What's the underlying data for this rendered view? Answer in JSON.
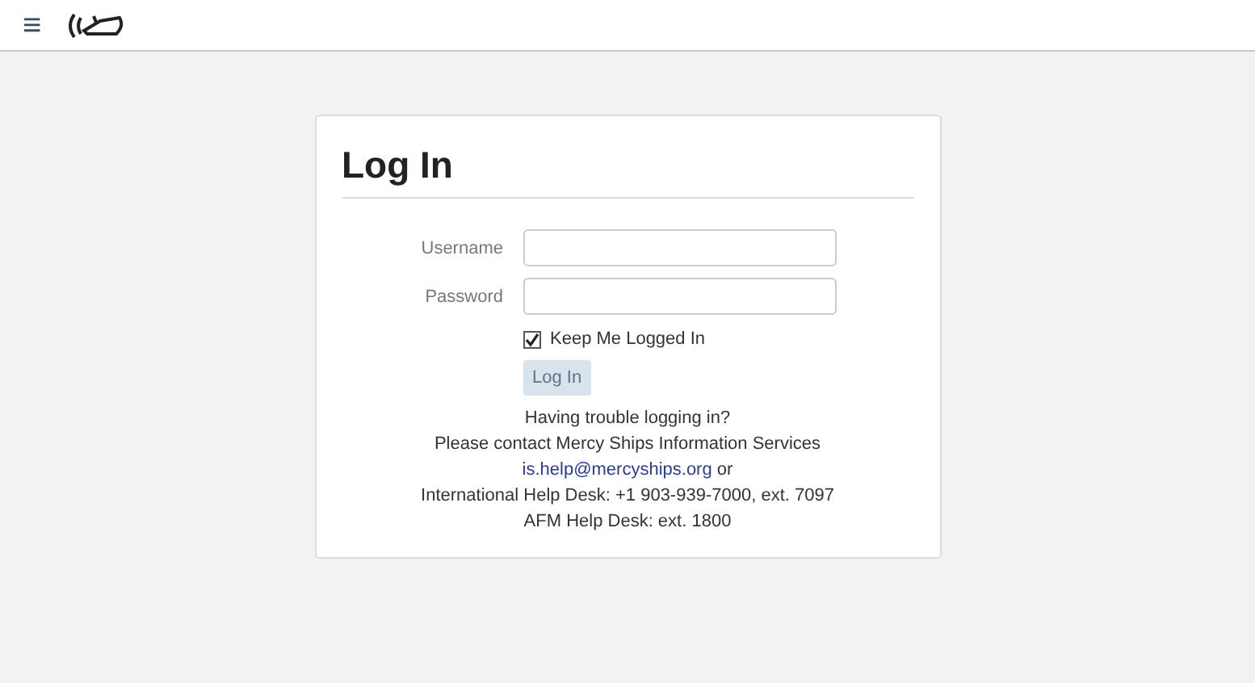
{
  "header": {
    "menu_glyph": "≡"
  },
  "login": {
    "title": "Log In",
    "fields": [
      {
        "label": "Username"
      },
      {
        "label": "Password"
      }
    ],
    "keep_logged_in": {
      "label": "Keep Me Logged In",
      "checked": true
    },
    "submit": {
      "label": "Log In",
      "disabled": true
    },
    "help": {
      "lines": [
        "Having trouble logging in?",
        "Please contact Mercy Ships Information Services"
      ],
      "email": "is.help@mercyships.org",
      "email_suffix": "or",
      "after": [
        "International Help Desk: +1 903-939-7000, ext. 7097",
        "AFM Help Desk: ext. 1800"
      ]
    }
  }
}
